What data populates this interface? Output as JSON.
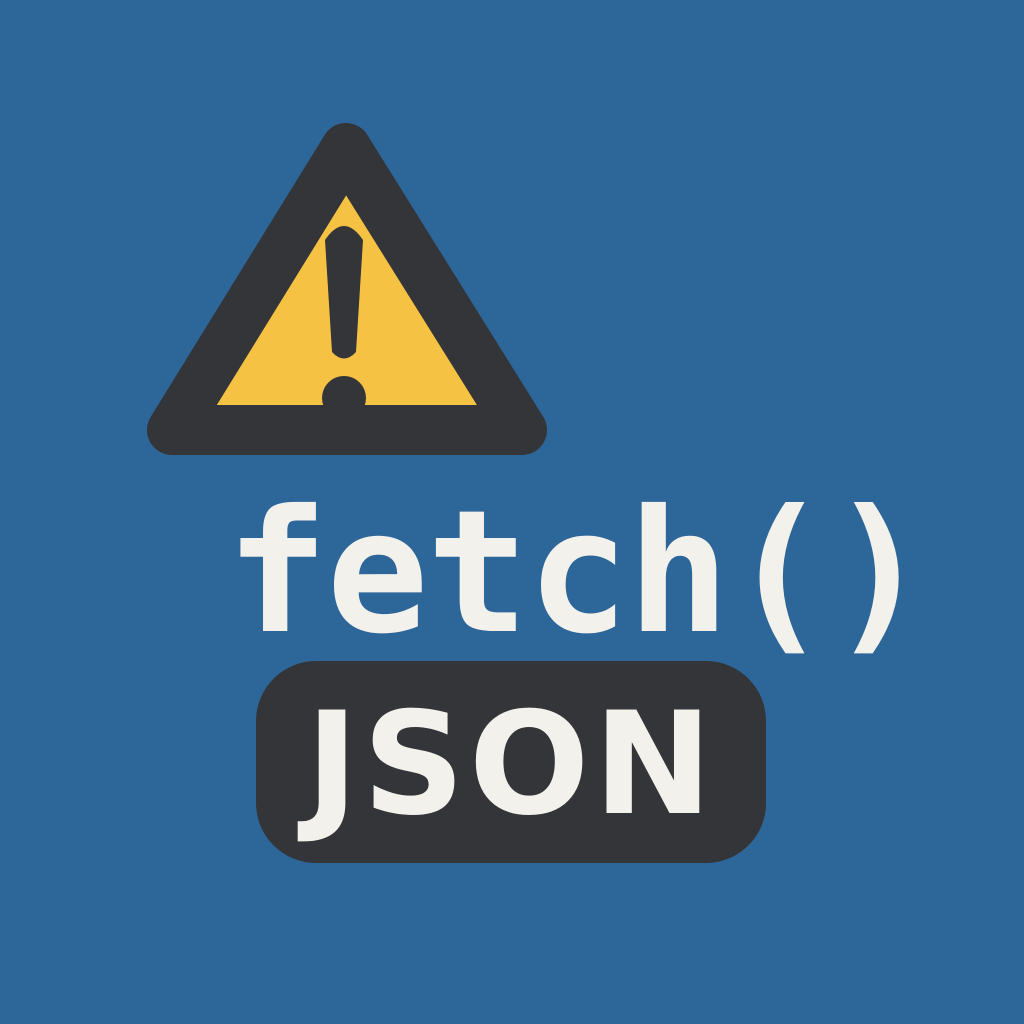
{
  "code": {
    "function_text": "fetch()"
  },
  "badge": {
    "label": "JSON"
  },
  "icons": {
    "warning": "warning-icon"
  },
  "colors": {
    "background": "#2d6699",
    "warning_fill": "#f6c244",
    "warning_outline": "#333538",
    "text": "#f3f1ec",
    "badge_fill": "#333538"
  }
}
